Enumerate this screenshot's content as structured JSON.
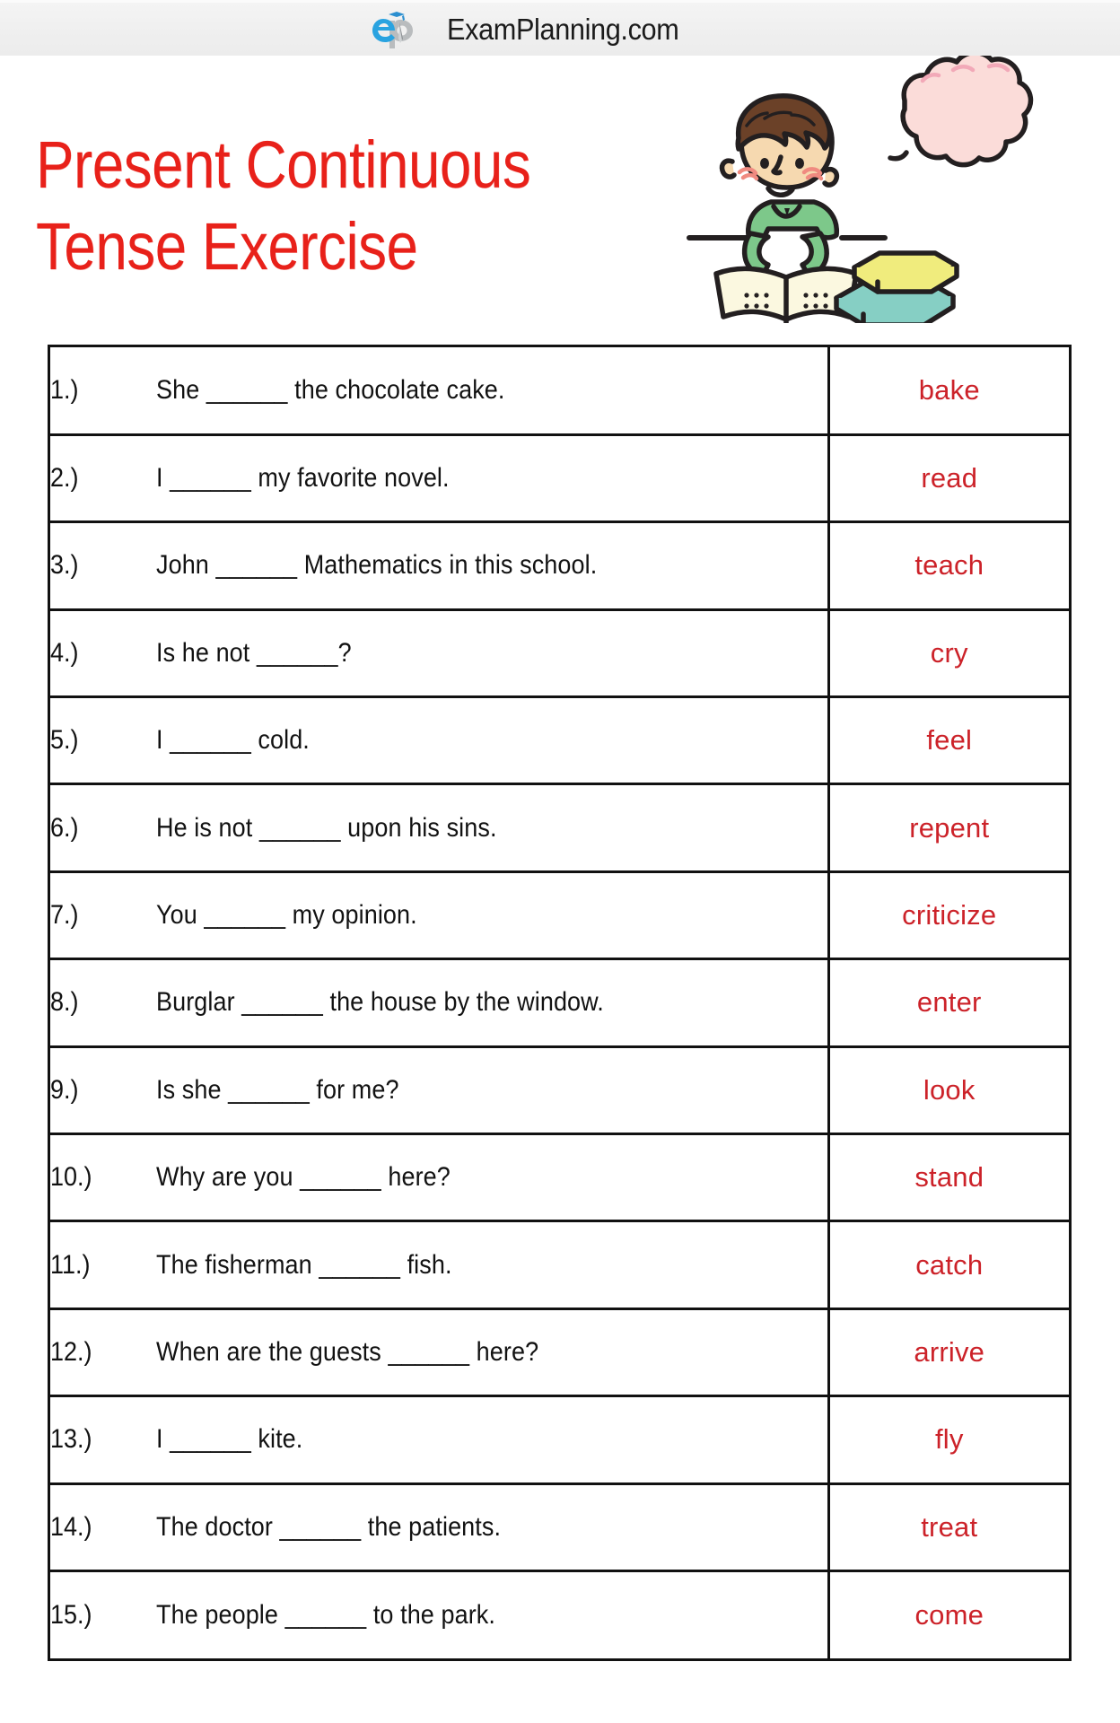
{
  "brand": {
    "logo_icon": "examplanning-logo-icon",
    "name": "ExamPlanning.com"
  },
  "title": {
    "line1": "Present Continuous",
    "line2": "Tense Exercise",
    "color": "#e8211a"
  },
  "illustration": {
    "name": "boy-reading-book-illustration",
    "elements": [
      "thought-bubble",
      "boy-with-brown-hair",
      "green-shirt",
      "open-book",
      "stacked-books"
    ],
    "colors": {
      "bubble_fill": "#fbdcd9",
      "skin": "#f6d9b0",
      "hair": "#6b4128",
      "shirt": "#7dc88a",
      "book_top": "#f0ec7d",
      "book_bottom": "#86cfc4",
      "page": "#fbf8e0",
      "outline": "#231f20",
      "blush": "#f08a80"
    }
  },
  "worksheet": {
    "blank": "______",
    "verb_color": "#cc2229",
    "rows": [
      {
        "num": "1.)",
        "sentence": "She ______ the chocolate cake.",
        "verb": "bake"
      },
      {
        "num": "2.)",
        "sentence": "I ______ my favorite novel.",
        "verb": "read"
      },
      {
        "num": "3.)",
        "sentence": "John ______ Mathematics in this school.",
        "verb": "teach"
      },
      {
        "num": "4.)",
        "sentence": "Is he not ______?",
        "verb": "cry"
      },
      {
        "num": "5.)",
        "sentence": "I ______ cold.",
        "verb": "feel"
      },
      {
        "num": "6.)",
        "sentence": "He is not ______ upon his sins.",
        "verb": "repent"
      },
      {
        "num": "7.)",
        "sentence": "You ______ my opinion.",
        "verb": "criticize"
      },
      {
        "num": "8.)",
        "sentence": "Burglar ______ the house by the window.",
        "verb": "enter"
      },
      {
        "num": "9.)",
        "sentence": "Is she ______ for me?",
        "verb": "look"
      },
      {
        "num": "10.)",
        "sentence": "Why are you ______ here?",
        "verb": "stand"
      },
      {
        "num": "11.)",
        "sentence": "The fisherman ______ fish.",
        "verb": "catch"
      },
      {
        "num": "12.)",
        "sentence": "When are the guests ______ here?",
        "verb": "arrive"
      },
      {
        "num": "13.)",
        "sentence": "I ______ kite.",
        "verb": "fly"
      },
      {
        "num": "14.)",
        "sentence": "The doctor ______ the patients.",
        "verb": "treat"
      },
      {
        "num": "15.)",
        "sentence": "The people ______ to the park.",
        "verb": "come"
      }
    ]
  }
}
